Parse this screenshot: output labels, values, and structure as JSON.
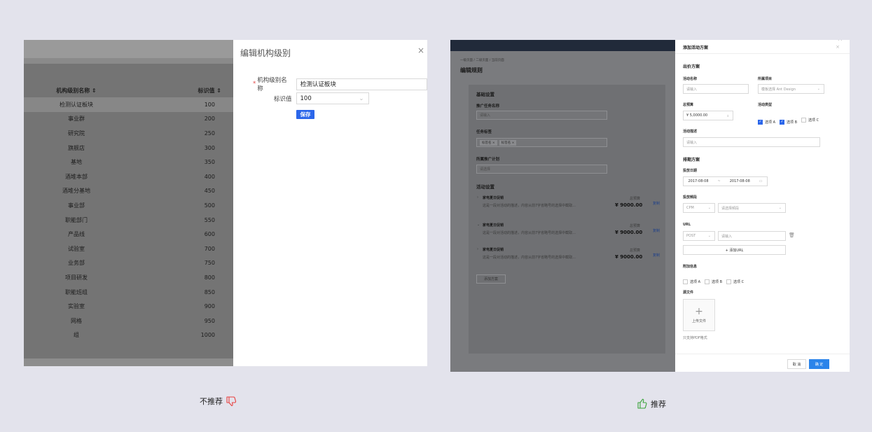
{
  "left": {
    "table": {
      "headers": [
        "机构级别名称 ⇕",
        "标识值 ⇕"
      ],
      "rows": [
        [
          "检测认证板块",
          "100"
        ],
        [
          "事业群",
          "200"
        ],
        [
          "研究院",
          "250"
        ],
        [
          "旗舰店",
          "300"
        ],
        [
          "基地",
          "350"
        ],
        [
          "酒堆本部",
          "400"
        ],
        [
          "酒堆分基地",
          "450"
        ],
        [
          "事业部",
          "500"
        ],
        [
          "职能部门",
          "550"
        ],
        [
          "产品线",
          "600"
        ],
        [
          "试验室",
          "700"
        ],
        [
          "业务部",
          "750"
        ],
        [
          "项目研发",
          "800"
        ],
        [
          "职能班组",
          "850"
        ],
        [
          "实验室",
          "900"
        ],
        [
          "网格",
          "950"
        ],
        [
          "组",
          "1000"
        ]
      ]
    },
    "drawer": {
      "title": "编辑机构级别",
      "close": "×",
      "name_label": "机构级别名称",
      "name_required": "*",
      "name_value": "检测认证板块",
      "code_label": "标识值",
      "code_value": "100",
      "save_label": "保存"
    },
    "caption": "不推荐"
  },
  "right": {
    "breadcrumb": "一级页面 / 二级页面 / 当前页面",
    "page_title": "编辑规则",
    "basic_section": "基础设置",
    "task_label": "推广任务名称",
    "task_placeholder": "请输入",
    "tags_label": "任务标签",
    "tags": [
      "标签名 ×",
      "标签名 ×"
    ],
    "plan_label": "所属推广计划",
    "plan_placeholder": "请选择",
    "activity_section": "活动设置",
    "activities": [
      {
        "title": "家电夏日促销",
        "desc": "这是一段对活动的描述，内容从前7字省略号的选择中截取...",
        "budget_label": "总预算",
        "amount": "¥ 9000.00",
        "link": "复制"
      },
      {
        "title": "家电夏日促销",
        "desc": "这是一段对活动的描述，内容从前7字省略号的选择中截取...",
        "budget_label": "总预算",
        "amount": "¥ 9000.00",
        "link": "复制"
      },
      {
        "title": "家电夏日促销",
        "desc": "这是一段对活动的描述，内容从前7字省略号的选择中截取...",
        "budget_label": "总预算",
        "amount": "¥ 9000.00",
        "link": "复制"
      }
    ],
    "add_plan_label": "添加方案",
    "drawer": {
      "title": "添加活动方案",
      "close": "×",
      "section1": "出价方案",
      "name_label": "活动名称",
      "name_placeholder": "请输入",
      "project_label": "所属项目",
      "project_placeholder": "模板选择 Ant Design",
      "budget_label": "总预算",
      "budget_value": "¥ 5,0000.00",
      "type_label": "活动类型",
      "type_options": [
        {
          "label": "选项 A",
          "checked": true
        },
        {
          "label": "选项 B",
          "checked": true
        },
        {
          "label": "选项 C",
          "checked": false
        }
      ],
      "desc_label": "活动描述",
      "desc_placeholder": "请输入",
      "section2": "排期方案",
      "date_label": "投放日期",
      "date_start": "2017-08-08",
      "date_sep": "~",
      "date_end": "2017-08-08",
      "freq_label": "投放频段",
      "freq_value": "CPM",
      "freq_placeholder": "请选择频段",
      "url_label": "URL",
      "url_method": "POST",
      "url_placeholder": "请输入",
      "add_url_label": "+ 添加URL",
      "extra_label": "附加信息",
      "extra_options": [
        {
          "label": "选项 A",
          "checked": false
        },
        {
          "label": "选项 B",
          "checked": false
        },
        {
          "label": "选项 C",
          "checked": false
        }
      ],
      "file_label": "源文件",
      "upload_label": "上传文件",
      "upload_hint": "只支持PDF格式",
      "cancel_label": "取 消",
      "ok_label": "确 定"
    },
    "caption": "推荐"
  }
}
